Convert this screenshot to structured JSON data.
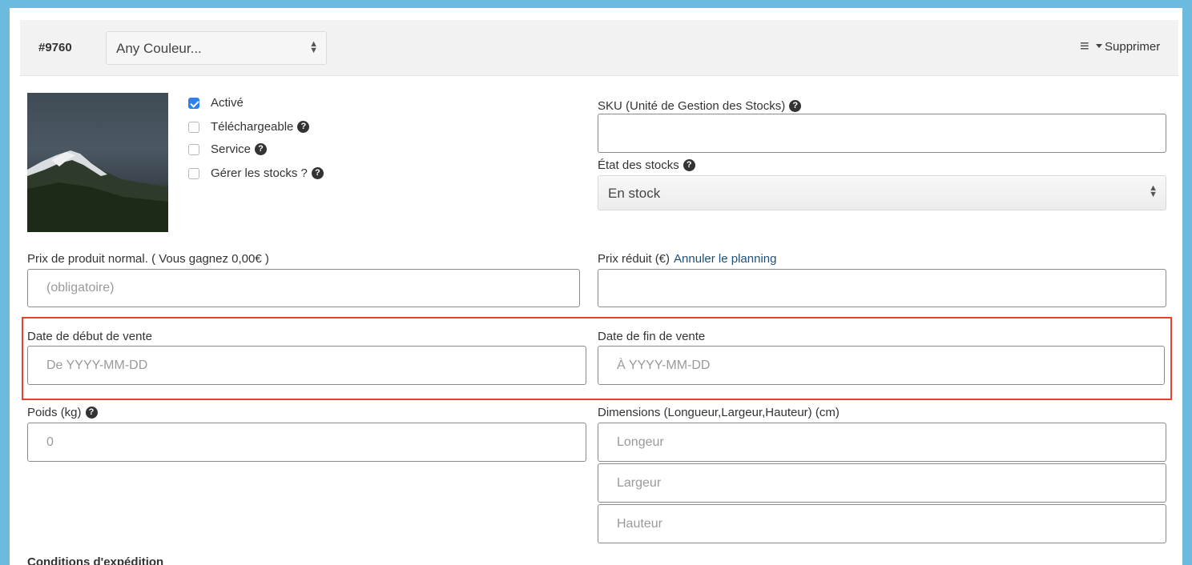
{
  "header": {
    "variation_id": "#9760",
    "color_select": "Any Couleur...",
    "delete_label": "Supprimer"
  },
  "checkboxes": [
    {
      "label": "Activé",
      "checked": true,
      "help": false
    },
    {
      "label": "Téléchargeable",
      "checked": false,
      "help": true
    },
    {
      "label": "Service",
      "checked": false,
      "help": true
    },
    {
      "label": "Gérer les stocks ?",
      "checked": false,
      "help": true
    }
  ],
  "sku": {
    "label": "SKU (Unité de Gestion des Stocks)",
    "value": ""
  },
  "stock_status": {
    "label": "État des stocks",
    "selected": "En stock"
  },
  "regular_price": {
    "label": "Prix de produit normal. ( Vous gagnez 0,00€ )",
    "placeholder": "(obligatoire)"
  },
  "sale_price": {
    "label": "Prix réduit (€)",
    "link": "Annuler le planning",
    "value": ""
  },
  "sale_start": {
    "label": "Date de début de vente",
    "placeholder": "De YYYY-MM-DD"
  },
  "sale_end": {
    "label": "Date de fin de vente",
    "placeholder": "À YYYY-MM-DD"
  },
  "weight": {
    "label": "Poids (kg)",
    "placeholder": "0"
  },
  "dimensions": {
    "label": "Dimensions (Longueur,Largeur,Hauteur) (cm)",
    "length_placeholder": "Longeur",
    "width_placeholder": "Largeur",
    "height_placeholder": "Hauteur"
  },
  "shipping_title": "Conditions d'expédition",
  "colors": {
    "highlight": "#e6442f",
    "checkbox_active": "#2f80ed",
    "link": "#1f4f7a",
    "frame": "#6cbade"
  },
  "icons": [
    "help-icon",
    "menu-icon",
    "caret-down-icon",
    "select-arrows-icon"
  ]
}
